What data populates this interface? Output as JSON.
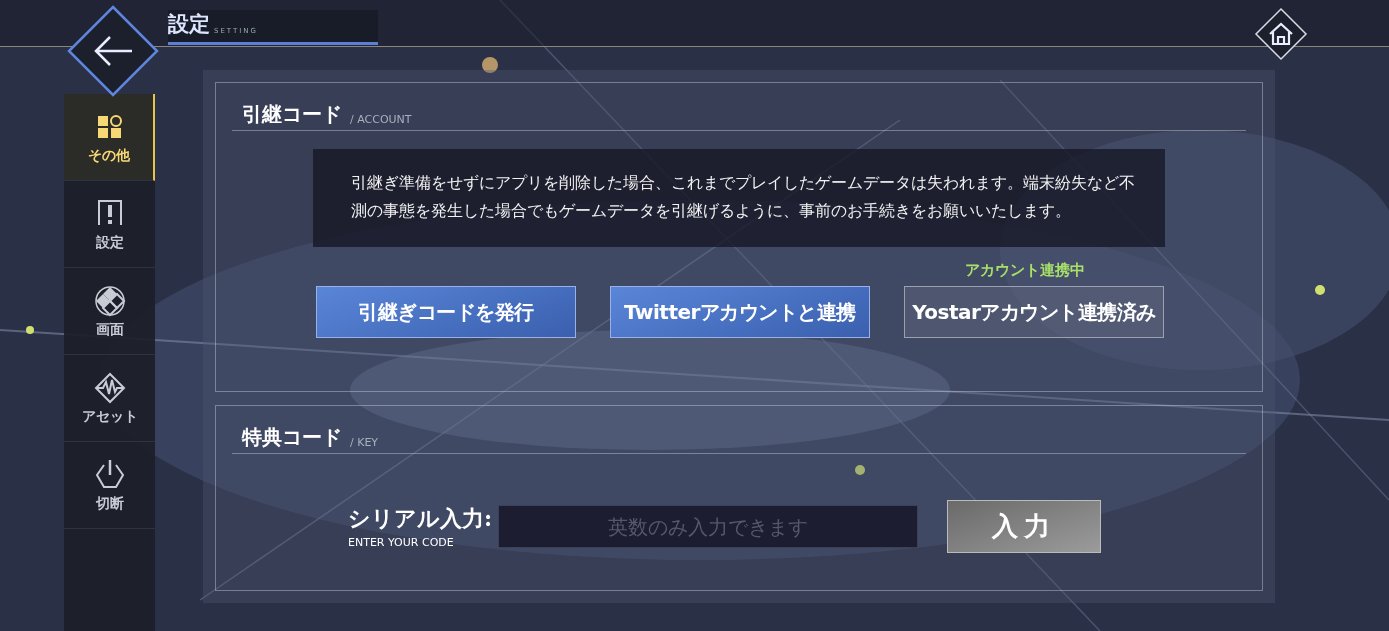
{
  "header": {
    "title": "設定",
    "subtitle": "SETTING"
  },
  "sidebar": {
    "items": [
      {
        "label": "その他",
        "kind": "grid",
        "selected": true
      },
      {
        "label": "設定",
        "kind": "option",
        "selected": false
      },
      {
        "label": "画面",
        "kind": "screen",
        "selected": false
      },
      {
        "label": "アセット",
        "kind": "asset",
        "selected": false
      },
      {
        "label": "切断",
        "kind": "power",
        "selected": false
      }
    ]
  },
  "account": {
    "title": "引継コード",
    "subtitle": "/ ACCOUNT",
    "notice": "引継ぎ準備をせずにアプリを削除した場合、これまでプレイしたゲームデータは失われます。端末紛失など不測の事態を発生した場合でもゲームデータを引継げるように、事前のお手続きをお願いいたします。",
    "status": "アカウント連携中",
    "buttons": [
      {
        "label": "引継ぎコードを発行",
        "kind": "primary"
      },
      {
        "label": "Twitterアカウントと連携",
        "kind": "primary"
      },
      {
        "label": "Yostarアカウント連携済み",
        "kind": "linked"
      }
    ]
  },
  "key": {
    "title": "特典コード",
    "subtitle": "/ KEY",
    "label": "シリアル入力:",
    "sublabel": "ENTER YOUR CODE",
    "placeholder": "英数のみ入力できます",
    "button": "入力"
  }
}
